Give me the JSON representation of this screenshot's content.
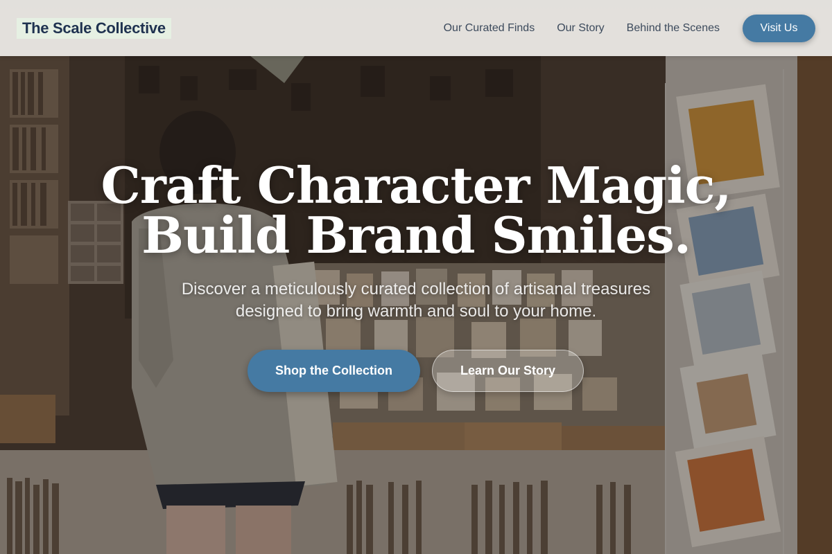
{
  "nav": {
    "brand": "The Scale Collective",
    "links": [
      {
        "label": "Our Curated Finds"
      },
      {
        "label": "Our Story"
      },
      {
        "label": "Behind the Scenes"
      }
    ],
    "cta_label": "Visit Us"
  },
  "hero": {
    "headline_line1": "Craft Character Magic,",
    "headline_line2": "Build Brand Smiles.",
    "subtitle": "Discover a meticulously curated collection of artisanal treasures designed to bring warmth and soul to your home.",
    "primary_button": "Shop the Collection",
    "secondary_button": "Learn Our Story",
    "background_image_label": "hero-background-shop-photo"
  },
  "colors": {
    "accent": "#457aa3",
    "brand_text": "#1f3250",
    "brand_highlight": "#e6f0e3",
    "nav_text": "#3c4a5c"
  }
}
